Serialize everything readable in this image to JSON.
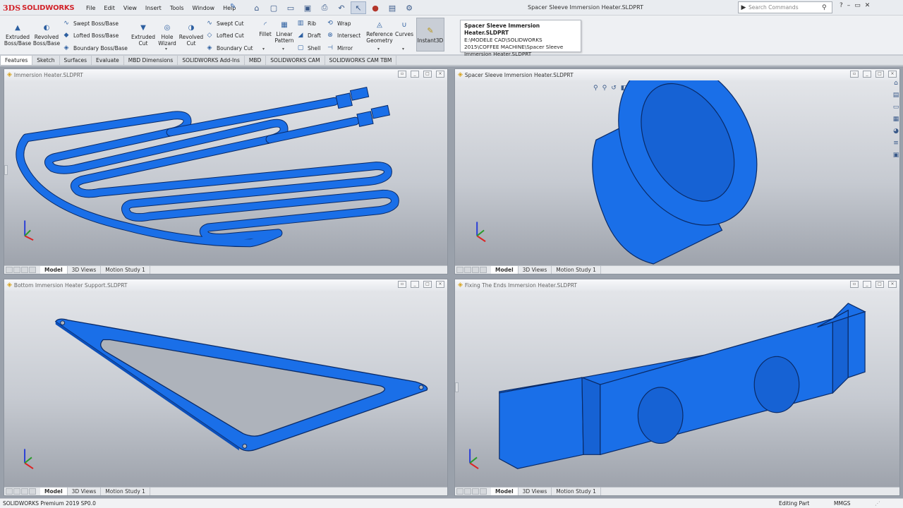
{
  "app": {
    "brand_prefix": "3DS",
    "brand_name": "SOLIDWORKS",
    "document_title": "Spacer Sleeve Immersion Heater.SLDPRT"
  },
  "menu": [
    "File",
    "Edit",
    "View",
    "Insert",
    "Tools",
    "Window",
    "Help"
  ],
  "search": {
    "placeholder": "Search Commands"
  },
  "ribbon": {
    "extruded_boss": "Extruded\nBoss/Base",
    "revolved_boss": "Revolved\nBoss/Base",
    "swept_boss": "Swept Boss/Base",
    "lofted_boss": "Lofted Boss/Base",
    "boundary_boss": "Boundary Boss/Base",
    "extruded_cut": "Extruded\nCut",
    "hole_wizard": "Hole\nWizard",
    "revolved_cut": "Revolved\nCut",
    "swept_cut": "Swept Cut",
    "lofted_cut": "Lofted Cut",
    "boundary_cut": "Boundary Cut",
    "fillet": "Fillet",
    "linear_pattern": "Linear\nPattern",
    "rib": "Rib",
    "draft": "Draft",
    "shell": "Shell",
    "wrap": "Wrap",
    "intersect": "Intersect",
    "mirror": "Mirror",
    "reference_geometry": "Reference\nGeometry",
    "curves": "Curves",
    "instant3d": "Instant3D"
  },
  "tooltip": {
    "title": "Spacer Sleeve Immersion Heater.SLDPRT",
    "path": "E:\\MODELE CAD\\SOLIDWORKS 2015\\COFFEE MACHINE\\Spacer Sleeve Immersion Heater.SLDPRT"
  },
  "tabs": [
    "Features",
    "Sketch",
    "Surfaces",
    "Evaluate",
    "MBD Dimensions",
    "SOLIDWORKS Add-Ins",
    "MBD",
    "SOLIDWORKS CAM",
    "SOLIDWORKS CAM TBM"
  ],
  "viewports": [
    {
      "title": "Immersion Heater.SLDPRT"
    },
    {
      "title": "Spacer Sleeve Immersion Heater.SLDPRT"
    },
    {
      "title": "Bottom Immersion Heater Support.SLDPRT"
    },
    {
      "title": "Fixing The Ends Immersion Heater.SLDPRT"
    }
  ],
  "view_tabs": {
    "model": "Model",
    "views3d": "3D Views",
    "motion": "Motion Study 1"
  },
  "status": {
    "product": "SOLIDWORKS Premium 2019 SP0.0",
    "mode": "Editing Part",
    "units": "MMGS"
  },
  "colors": {
    "part_blue": "#1a6fe8",
    "part_edge": "#0a2a66",
    "brand_red": "#d2232a"
  }
}
